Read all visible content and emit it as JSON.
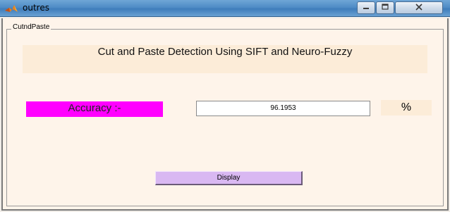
{
  "window": {
    "title": "outres"
  },
  "panel": {
    "title": "CutndPaste"
  },
  "heading": {
    "text": "Cut and Paste Detection Using SIFT and Neuro-Fuzzy"
  },
  "accuracy": {
    "label": "Accuracy :-",
    "value": "96.1953",
    "unit": "%"
  },
  "actions": {
    "display_label": "Display"
  },
  "colors": {
    "accuracy_label_bg": "#ff00ff",
    "display_button_bg": "#d9b8f2",
    "panel_bg": "#fef4ea",
    "heading_bg": "#fcecd8"
  },
  "icons": {
    "app": "matlab-icon",
    "minimize": "minimize-icon",
    "maximize": "maximize-icon",
    "close": "close-icon"
  }
}
